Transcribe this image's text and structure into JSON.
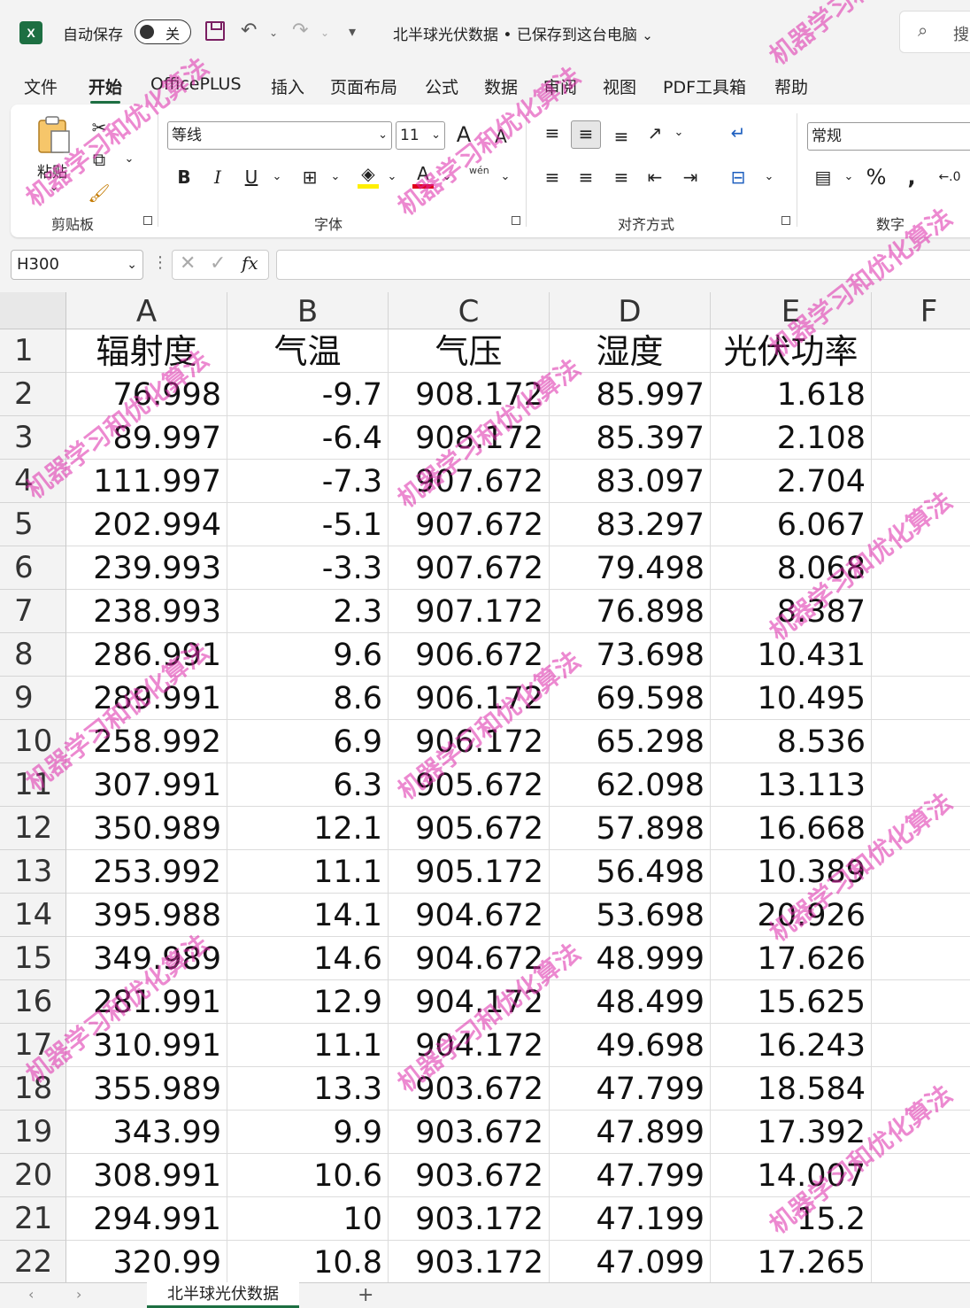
{
  "titlebar": {
    "autosave_label": "自动保存",
    "autosave_state": "关",
    "document_title": "北半球光伏数据 • 已保存到这台电脑",
    "search_placeholder": "搜"
  },
  "ribbon_tabs": [
    "文件",
    "开始",
    "OfficePLUS",
    "插入",
    "页面布局",
    "公式",
    "数据",
    "审阅",
    "视图",
    "PDF工具箱",
    "帮助"
  ],
  "active_tab": "开始",
  "ribbon": {
    "clipboard": {
      "paste_label": "粘贴",
      "group_label": "剪贴板"
    },
    "font": {
      "font_name": "等线",
      "font_size": "11",
      "group_label": "字体",
      "bold": "B",
      "italic": "I",
      "underline": "U",
      "phonetic": "wén"
    },
    "alignment": {
      "group_label": "对齐方式"
    },
    "number": {
      "format": "常规",
      "group_label": "数字",
      "percent": "%"
    }
  },
  "formula_bar": {
    "name_box": "H300",
    "fx": "fx",
    "formula": ""
  },
  "columns": [
    "A",
    "B",
    "C",
    "D",
    "E",
    "F"
  ],
  "headers": [
    "辐射度",
    "气温",
    "气压",
    "湿度",
    "光伏功率"
  ],
  "rows": [
    [
      "76.998",
      "-9.7",
      "908.172",
      "85.997",
      "1.618"
    ],
    [
      "89.997",
      "-6.4",
      "908.172",
      "85.397",
      "2.108"
    ],
    [
      "111.997",
      "-7.3",
      "907.672",
      "83.097",
      "2.704"
    ],
    [
      "202.994",
      "-5.1",
      "907.672",
      "83.297",
      "6.067"
    ],
    [
      "239.993",
      "-3.3",
      "907.672",
      "79.498",
      "8.068"
    ],
    [
      "238.993",
      "2.3",
      "907.172",
      "76.898",
      "8.387"
    ],
    [
      "286.991",
      "9.6",
      "906.672",
      "73.698",
      "10.431"
    ],
    [
      "289.991",
      "8.6",
      "906.172",
      "69.598",
      "10.495"
    ],
    [
      "258.992",
      "6.9",
      "906.172",
      "65.298",
      "8.536"
    ],
    [
      "307.991",
      "6.3",
      "905.672",
      "62.098",
      "13.113"
    ],
    [
      "350.989",
      "12.1",
      "905.672",
      "57.898",
      "16.668"
    ],
    [
      "253.992",
      "11.1",
      "905.172",
      "56.498",
      "10.389"
    ],
    [
      "395.988",
      "14.1",
      "904.672",
      "53.698",
      "20.926"
    ],
    [
      "349.989",
      "14.6",
      "904.672",
      "48.999",
      "17.626"
    ],
    [
      "281.991",
      "12.9",
      "904.172",
      "48.499",
      "15.625"
    ],
    [
      "310.991",
      "11.1",
      "904.172",
      "49.698",
      "16.243"
    ],
    [
      "355.989",
      "13.3",
      "903.672",
      "47.799",
      "18.584"
    ],
    [
      "343.99",
      "9.9",
      "903.672",
      "47.899",
      "17.392"
    ],
    [
      "308.991",
      "10.6",
      "903.672",
      "47.799",
      "14.007"
    ],
    [
      "294.991",
      "10",
      "903.172",
      "47.199",
      "15.2"
    ],
    [
      "320.99",
      "10.8",
      "903.172",
      "47.099",
      "17.265"
    ]
  ],
  "sheet_tab": "北半球光伏数据",
  "add_sheet": "+",
  "watermark": "机器学习和优化算法",
  "colors": {
    "excel_green": "#1d6f42",
    "watermark": "#dc28aa",
    "save_icon": "#7a1f62"
  }
}
